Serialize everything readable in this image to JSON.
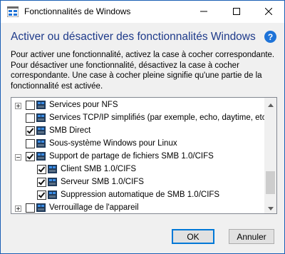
{
  "window": {
    "title": "Fonctionnalités de Windows",
    "icon": "windows-features-icon",
    "controls": [
      "minimize-icon",
      "maximize-icon",
      "close-icon"
    ]
  },
  "heading": "Activer ou désactiver des fonctionnalités Windows",
  "description": [
    "Pour activer une fonctionnalité, activez la case à cocher correspondante.",
    "Pour désactiver une fonctionnalité, désactivez la case à cocher",
    "correspondante. Une case à cocher pleine signifie qu'une partie de la",
    "fonctionnalité est activée."
  ],
  "features": [
    {
      "label": "Services pour NFS",
      "checked": false,
      "expander": "plus",
      "level": 0
    },
    {
      "label": "Services TCP/IP simplifiés (par exemple, echo, daytime, etc.)",
      "checked": false,
      "expander": "none",
      "level": 0
    },
    {
      "label": "SMB Direct",
      "checked": true,
      "expander": "none",
      "level": 0
    },
    {
      "label": "Sous-système Windows pour Linux",
      "checked": false,
      "expander": "none",
      "level": 0
    },
    {
      "label": "Support de partage de fichiers SMB 1.0/CIFS",
      "checked": true,
      "expander": "minus",
      "level": 0
    },
    {
      "label": "Client SMB 1.0/CIFS",
      "checked": true,
      "expander": "none",
      "level": 1
    },
    {
      "label": "Serveur SMB 1.0/CIFS",
      "checked": true,
      "expander": "none",
      "level": 1
    },
    {
      "label": "Suppression automatique de SMB 1.0/CIFS",
      "checked": true,
      "expander": "none",
      "level": 1
    },
    {
      "label": "Verrouillage de l'appareil",
      "checked": false,
      "expander": "plus",
      "level": 0
    }
  ],
  "buttons": {
    "ok": "OK",
    "cancel": "Annuler"
  },
  "colors": {
    "heading": "#1e3a8a",
    "accent": "#0078d7",
    "folder_icon": "#1f3a5a"
  }
}
